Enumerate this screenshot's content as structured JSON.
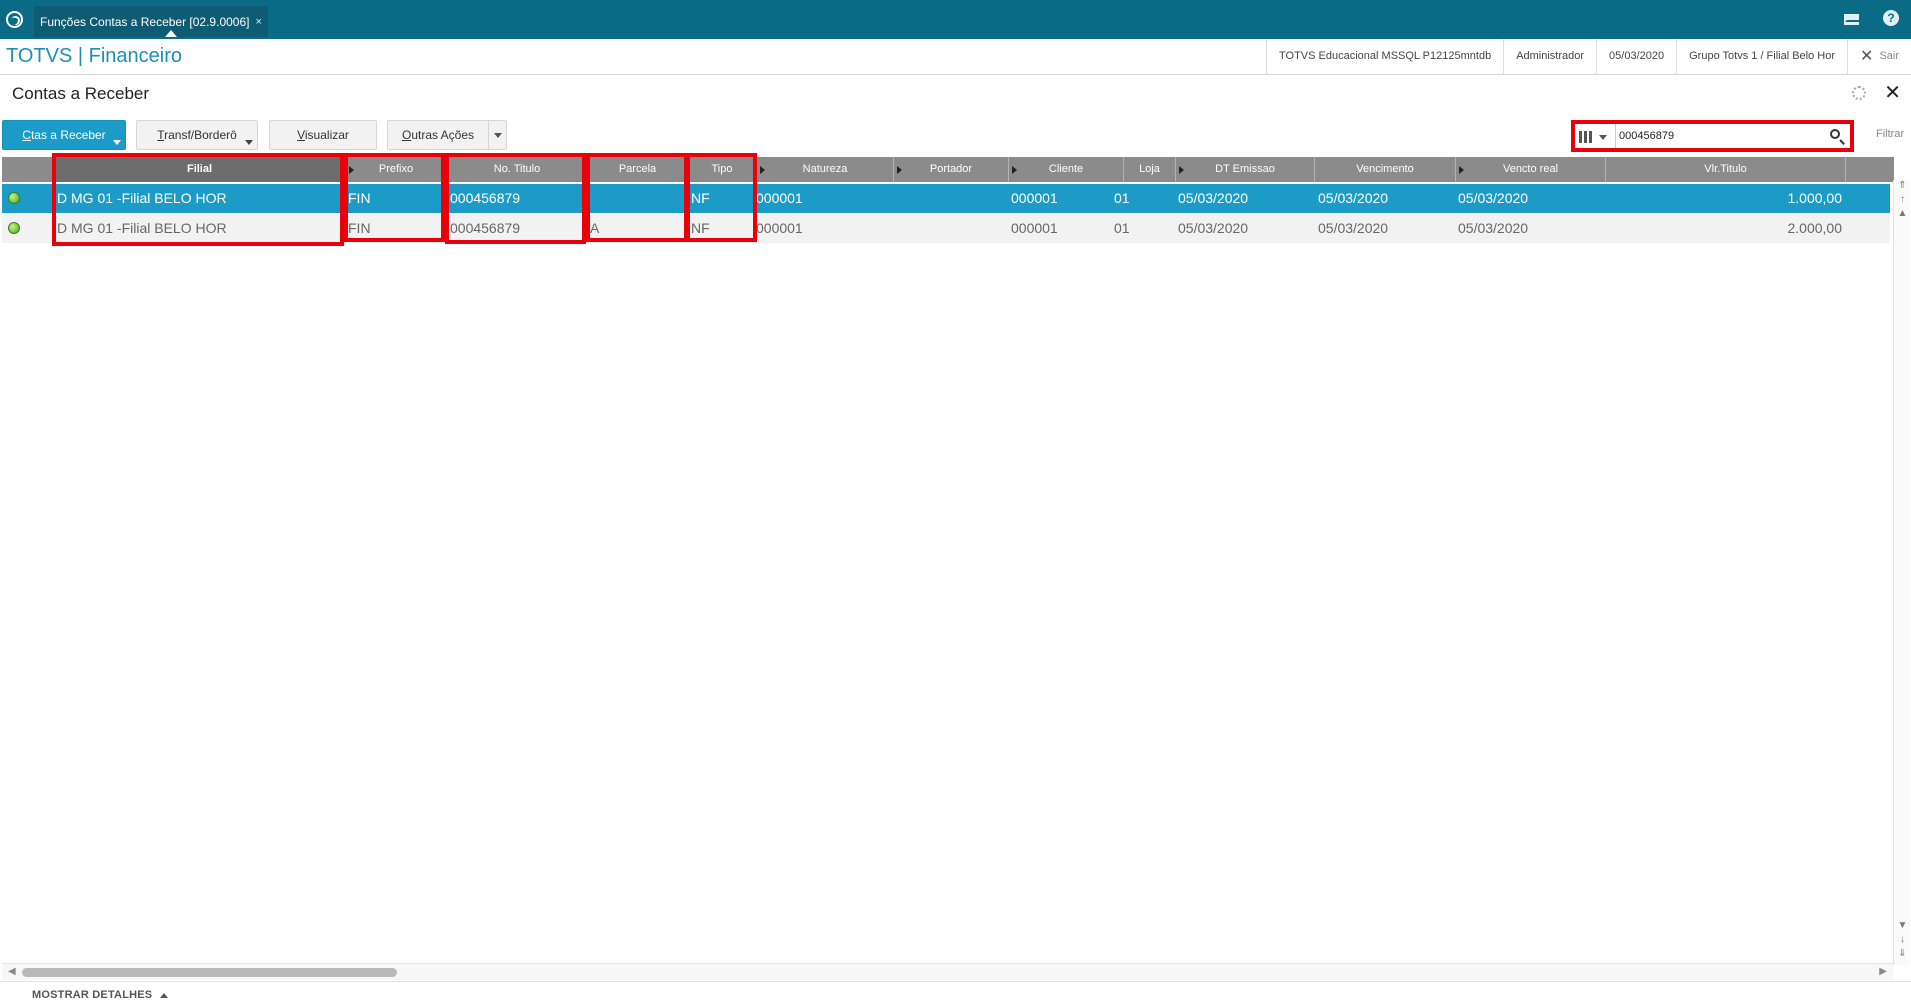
{
  "window": {
    "tab_title": "Funções Contas a Receber [02.9.0006]",
    "tab_close": "×",
    "help_glyph": "?"
  },
  "header": {
    "brand": "TOTVS | Financeiro",
    "environment": "TOTVS Educacional MSSQL P12125mntdb",
    "user": "Administrador",
    "date": "05/03/2020",
    "branch": "Grupo Totvs 1 / Filial Belo Hor",
    "exit_label": "Sair"
  },
  "page": {
    "title": "Contas a Receber",
    "close_glyph": "✕"
  },
  "toolbar": {
    "primary": {
      "hotkey": "C",
      "rest": "tas a Receber"
    },
    "transf": {
      "hotkey": "T",
      "rest": "ransf/Borderô"
    },
    "visualizar": {
      "hotkey": "V",
      "rest": "isualizar"
    },
    "outras": {
      "hotkey": "O",
      "rest": "utras Ações"
    }
  },
  "search": {
    "value": "000456879",
    "filter_label": "Filtrar"
  },
  "grid": {
    "columns": [
      "Filial",
      "Prefixo",
      "No. Titulo",
      "Parcela",
      "Tipo",
      "Natureza",
      "Portador",
      "Cliente",
      "Loja",
      "DT Emissao",
      "Vencimento",
      "Vencto real",
      "Vlr.Titulo"
    ],
    "rows": [
      {
        "selected": true,
        "filial": "D MG 01 -Filial BELO HOR",
        "prefixo": "FIN",
        "titulo": "000456879",
        "parcela": "",
        "tipo": "NF",
        "natureza": "000001",
        "portador": "",
        "cliente": "000001",
        "loja": "01",
        "emissao": "05/03/2020",
        "vencimento": "05/03/2020",
        "vencto_real": "05/03/2020",
        "valor": "1.000,00"
      },
      {
        "selected": false,
        "filial": "D MG 01 -Filial BELO HOR",
        "prefixo": "FIN",
        "titulo": "000456879",
        "parcela": "A",
        "tipo": "NF",
        "natureza": "000001",
        "portador": "",
        "cliente": "000001",
        "loja": "01",
        "emissao": "05/03/2020",
        "vencimento": "05/03/2020",
        "vencto_real": "05/03/2020",
        "valor": "2.000,00"
      }
    ]
  },
  "footer": {
    "details_label": "MOSTRAR DETALHES"
  },
  "colors": {
    "topbar": "#0b6b87",
    "accent": "#1b9bc6",
    "highlight": "#e8000b",
    "header_grid": "#8b8b8b"
  },
  "icons": [
    "totvs-logo-icon",
    "mail-icon",
    "help-icon",
    "gear-icon",
    "close-icon",
    "columns-icon",
    "search-icon",
    "status-green-icon"
  ]
}
